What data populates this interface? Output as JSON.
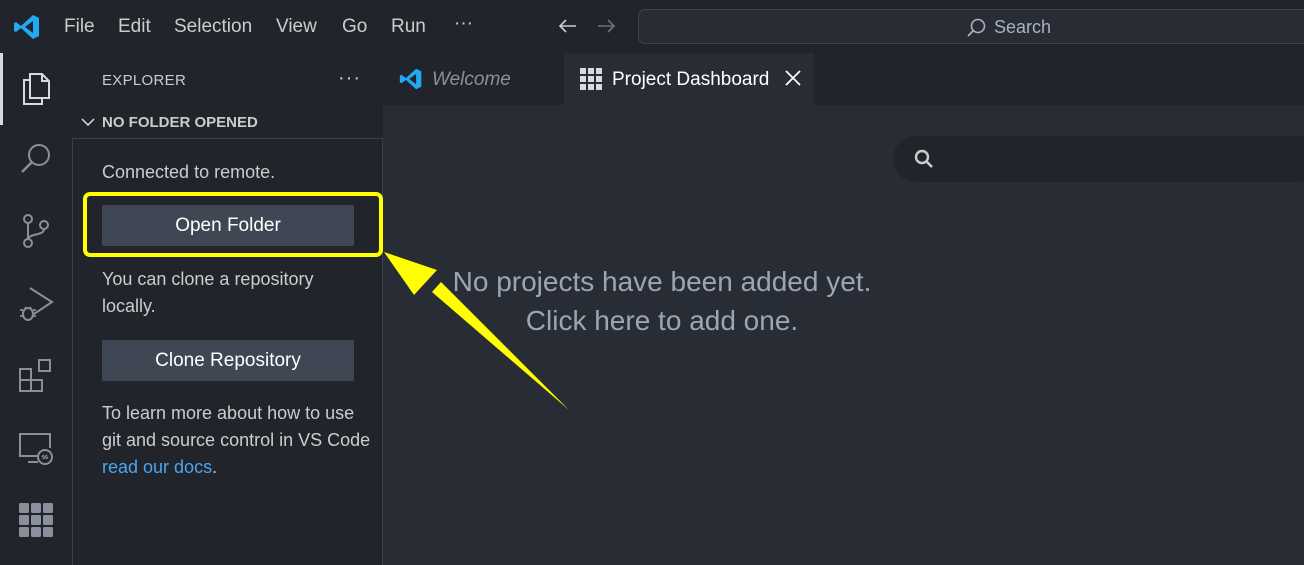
{
  "titlebar": {
    "menu": [
      "File",
      "Edit",
      "Selection",
      "View",
      "Go",
      "Run",
      "···"
    ],
    "search_label": "Search"
  },
  "activitybar": {
    "icons": [
      "files-icon",
      "search-icon",
      "source-control-icon",
      "run-debug-icon",
      "extensions-icon",
      "remote-explorer-icon",
      "project-dashboard-icon"
    ]
  },
  "sidebar": {
    "title": "EXPLORER",
    "more": "···",
    "section_title": "NO FOLDER OPENED",
    "connected_text": "Connected to remote.",
    "open_folder_label": "Open Folder",
    "clone_text": "You can clone a repository locally.",
    "clone_button_label": "Clone Repository",
    "learn_text_before": "To learn more about how to use git and source control in VS Code ",
    "learn_link": "read our docs",
    "learn_text_after": "."
  },
  "tabs": [
    {
      "label": "Welcome",
      "active": false,
      "italic": true
    },
    {
      "label": "Project Dashboard",
      "active": true
    }
  ],
  "editor": {
    "empty_line1": "No projects have been added yet.",
    "empty_line2": "Click here to add one."
  },
  "colors": {
    "accent_blue": "#23a9f2",
    "highlight": "#ffff00",
    "link": "#4aa5f0"
  }
}
